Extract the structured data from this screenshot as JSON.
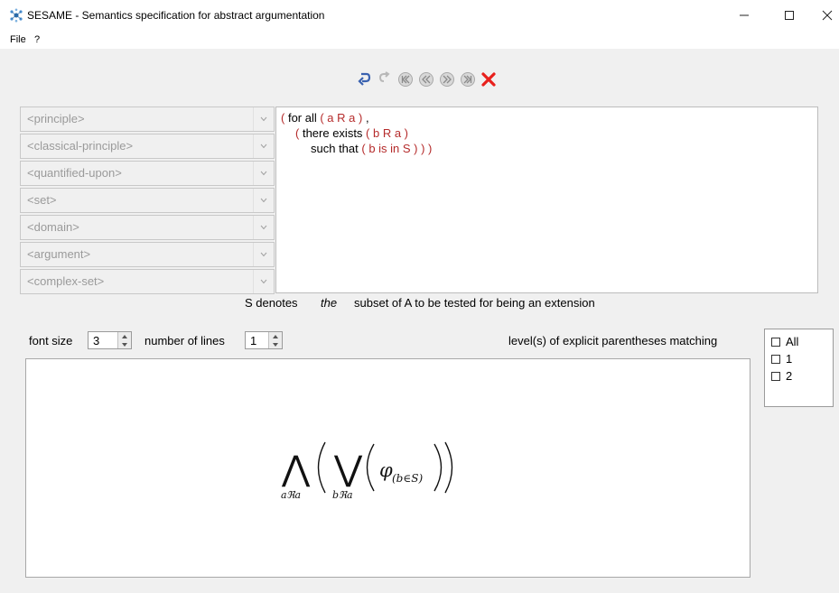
{
  "window": {
    "title": "SESAME - Semantics specification for abstract argumentation",
    "icon": "sesame-app-icon",
    "controls": [
      "minimize",
      "maximize",
      "close"
    ]
  },
  "menu": {
    "file": "File",
    "help": "?"
  },
  "toolbar": {
    "icons": [
      "undo-icon",
      "redo-icon",
      "first-icon",
      "previous-icon",
      "next-icon",
      "last-icon",
      "delete-icon"
    ]
  },
  "grammar_selectors": [
    {
      "label": "<principle>"
    },
    {
      "label": "<classical-principle>"
    },
    {
      "label": "<quantified-upon>"
    },
    {
      "label": "<set>"
    },
    {
      "label": "<domain>"
    },
    {
      "label": "<argument>"
    },
    {
      "label": "<complex-set>"
    }
  ],
  "formula": {
    "line1": {
      "open": "(",
      "text": " for all ",
      "group": "( a R a )",
      "tail": " ,"
    },
    "line2": {
      "open": "(",
      "text": " there exists ",
      "group": "( b R a )"
    },
    "line3": {
      "text": "such that ",
      "group": "( b is in S )",
      "close": " ) )"
    }
  },
  "caption": {
    "part1": "S denotes",
    "emphasis": "the",
    "part2": "subset of A to be tested for being an extension"
  },
  "controls": {
    "font_size_label": "font size",
    "font_size_value": "3",
    "lines_label": "number of lines",
    "lines_value": "1",
    "paren_label": "level(s) of explicit parentheses matching"
  },
  "paren_levels": [
    {
      "label": "All",
      "checked": false
    },
    {
      "label": "1",
      "checked": false
    },
    {
      "label": "2",
      "checked": false
    }
  ],
  "rendered_formula": {
    "outer_op": "⋀",
    "outer_sub": "aℜa",
    "inner_op": "⋁",
    "inner_sub": "bℜa",
    "phi": "φ",
    "phi_sub": "(b∈S)"
  },
  "colors": {
    "paren": "#b52b2b",
    "delete": "#e8201c",
    "nav": "#9a9a9a",
    "undo": "#3a62b0"
  }
}
